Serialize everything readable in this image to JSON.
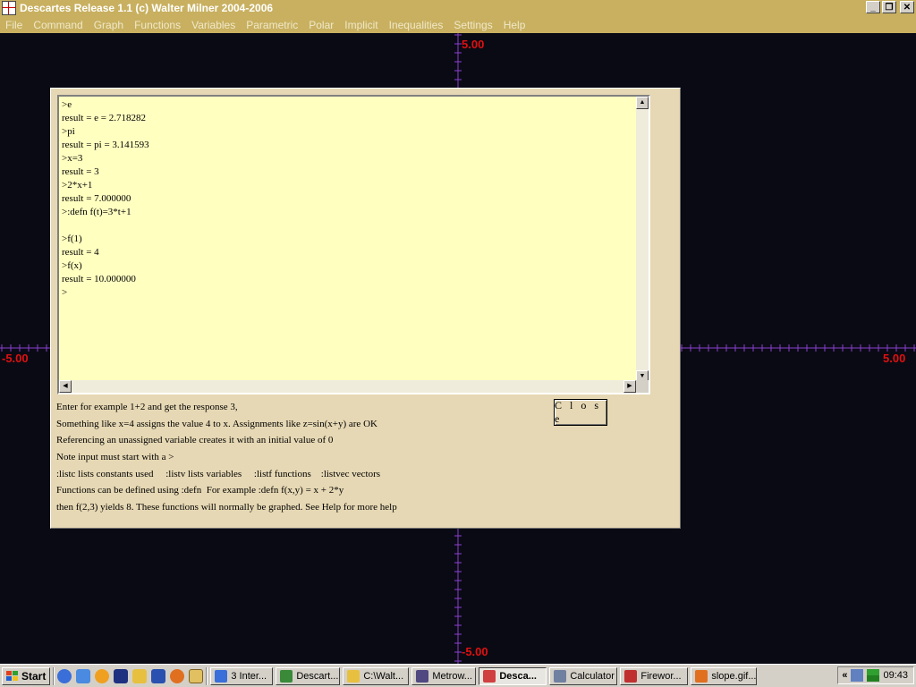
{
  "window": {
    "title": "Descartes Release 1.1 (c) Walter Milner 2004-2006",
    "minimize": "_",
    "restore": "❐",
    "close": "✕"
  },
  "menu": [
    "File",
    "Command",
    "Graph",
    "Functions",
    "Variables",
    "Parametric",
    "Polar",
    "Implicit",
    "Inequalities",
    "Settings",
    "Help"
  ],
  "graph": {
    "y_max_label": "5.00",
    "y_min_label": "-5.00",
    "x_min_label": "-5.00",
    "x_max_label": "5.00",
    "axis_color": "#8a3fd0",
    "label_color": "#e01010"
  },
  "console": {
    "lines": [
      ">e",
      "result = e = 2.718282",
      ">pi",
      "result = pi = 3.141593",
      ">x=3",
      "result = 3",
      ">2*x+1",
      "result = 7.000000",
      ">:defn f(t)=3*t+1",
      "",
      ">f(1)",
      "result = 4",
      ">f(x)",
      "result = 10.000000",
      ">"
    ]
  },
  "close_button": "C l o s e",
  "help": [
    "Enter for example 1+2 and get the response 3,",
    "Something like x=4 assigns the value 4 to x. Assignments like z=sin(x+y) are OK",
    "Referencing an unassigned variable creates it with an initial value of 0",
    "Note input must start with a >",
    ":listc lists constants used     :listv lists variables     :listf functions    :listvec vectors",
    "Functions can be defined using :defn  For example :defn f(x,y) = x + 2*y",
    "then f(2,3) yields 8. These functions will normally be graphed. See Help for more help"
  ],
  "taskbar": {
    "start": "Start",
    "quicklaunch_icons": [
      "internet-explorer-icon",
      "ie-alt-icon",
      "media-player-icon",
      "mathtype-icon",
      "folder-icon",
      "word-icon",
      "firefox-icon",
      "clock-app-icon"
    ],
    "tasks": [
      {
        "label": "3 Inter...",
        "icon": "internet-explorer-icon",
        "color": "#3a6ed8",
        "active": false
      },
      {
        "label": "Descart...",
        "icon": "descartes-green-icon",
        "color": "#3a8a3a",
        "active": false
      },
      {
        "label": "C:\\Walt...",
        "icon": "folder-icon",
        "color": "#e8c040",
        "active": false
      },
      {
        "label": "Metrow...",
        "icon": "metrowerks-icon",
        "color": "#504880",
        "active": false
      },
      {
        "label": "Desca...",
        "icon": "descartes-icon",
        "color": "#d04040",
        "active": true
      },
      {
        "label": "Calculator",
        "icon": "calculator-icon",
        "color": "#7080a0",
        "active": false
      },
      {
        "label": "Firewor...",
        "icon": "fireworks-icon",
        "color": "#c03030",
        "active": false
      },
      {
        "label": "slope.gif...",
        "icon": "firefox-icon",
        "color": "#e07020",
        "active": false
      }
    ],
    "tray_chevron": "«",
    "time": "09:43"
  }
}
